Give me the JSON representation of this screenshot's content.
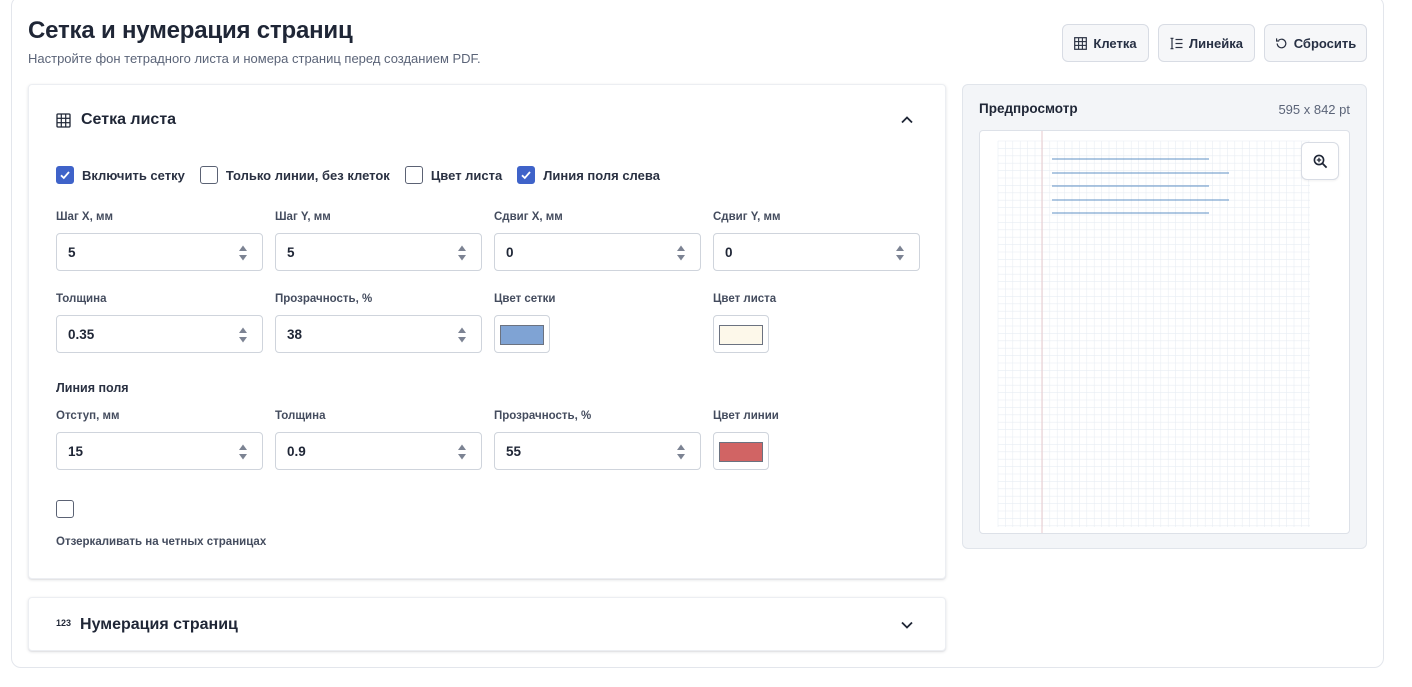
{
  "header": {
    "title": "Сетка и нумерация страниц",
    "subtitle": "Настройте фон тетрадного листа и номера страниц перед созданием PDF.",
    "buttons": {
      "grid": "Клетка",
      "ruler": "Линейка",
      "reset": "Сбросить"
    }
  },
  "grid_section": {
    "title": "Сетка листа",
    "checkboxes": [
      {
        "label": "Включить сетку",
        "checked": true
      },
      {
        "label": "Только линии, без клеток",
        "checked": false
      },
      {
        "label": "Цвет листа",
        "checked": false
      },
      {
        "label": "Линия поля слева",
        "checked": true
      }
    ],
    "step_x": {
      "label": "Шаг X, мм",
      "value": "5"
    },
    "step_y": {
      "label": "Шаг Y, мм",
      "value": "5"
    },
    "offset_x": {
      "label": "Сдвиг X, мм",
      "value": "0"
    },
    "offset_y": {
      "label": "Сдвиг Y, мм",
      "value": "0"
    },
    "thickness": {
      "label": "Толщина",
      "value": "0.35"
    },
    "opacity": {
      "label": "Прозрачность, %",
      "value": "38"
    },
    "grid_color": {
      "label": "Цвет сетки",
      "color": "#7fa3d4"
    },
    "sheet_color": {
      "label": "Цвет листа",
      "color": "#fdf8ea"
    },
    "margin_line": {
      "title": "Линия поля",
      "indent": {
        "label": "Отступ, мм",
        "value": "15"
      },
      "thickness": {
        "label": "Толщина",
        "value": "0.9"
      },
      "opacity": {
        "label": "Прозрачность, %",
        "value": "55"
      },
      "color": {
        "label": "Цвет линии",
        "color": "#d16464"
      }
    },
    "mirror": {
      "label": "Отзеркаливать на четных страницах",
      "checked": false
    }
  },
  "numbering_section": {
    "icon_text": "123",
    "title": "Нумерация страниц"
  },
  "preview": {
    "title": "Предпросмотр",
    "size": "595 x 842 pt",
    "grid_color": "#e8edf3",
    "margin_color": "#e7c9cc",
    "text_line_color": "#5f90c4"
  },
  "colors": {
    "accent": "#3f63c9"
  }
}
